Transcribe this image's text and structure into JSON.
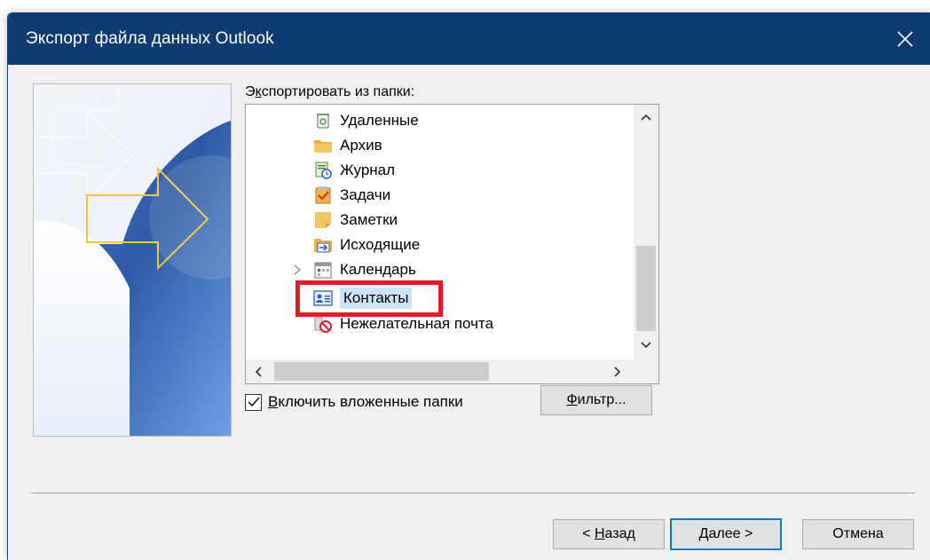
{
  "window": {
    "title": "Экспорт файла данных Outlook",
    "close_glyph": "✕"
  },
  "section": {
    "label_prefix": "Э",
    "label_accel": "к",
    "label_rest": "спортировать из папки:"
  },
  "tree": {
    "items": [
      {
        "label": "Удаленные",
        "icon": "deleted-items-icon"
      },
      {
        "label": "Архив",
        "icon": "folder-icon"
      },
      {
        "label": "Журнал",
        "icon": "journal-icon"
      },
      {
        "label": "Задачи",
        "icon": "tasks-icon"
      },
      {
        "label": "Заметки",
        "icon": "notes-icon"
      },
      {
        "label": "Исходящие",
        "icon": "outbox-icon"
      },
      {
        "label": "Календарь",
        "icon": "calendar-icon"
      },
      {
        "label": "Контакты",
        "icon": "contacts-icon",
        "selected": true
      },
      {
        "label": "Нежелательная почта",
        "icon": "junk-mail-icon"
      }
    ],
    "highlight_color": "#e21b2b",
    "selection_color": "#cce4f7"
  },
  "options": {
    "include_subfolders_accel": "В",
    "include_subfolders_rest": "ключить вложенные папки",
    "include_subfolders_checked": true
  },
  "buttons": {
    "filter_accel": "Ф",
    "filter_rest": "ильтр...",
    "back_prefix": "< ",
    "back_accel": "Н",
    "back_rest": "азад",
    "next_accel": "Д",
    "next_rest": "алее >",
    "cancel": "Отмена"
  },
  "colors": {
    "titlebar": "#0f3b70",
    "dialog_bg": "#f0f0f0",
    "default_button_border": "#0078d7"
  }
}
